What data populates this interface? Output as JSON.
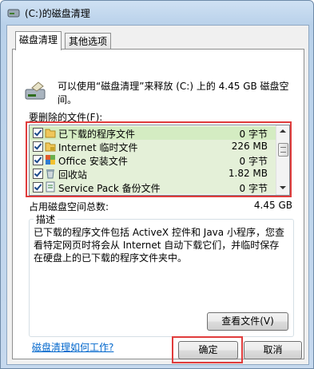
{
  "window": {
    "title": "(C:)的磁盘清理"
  },
  "tabs": [
    {
      "label": "磁盘清理"
    },
    {
      "label": "其他选项"
    }
  ],
  "intro": {
    "text": "可以使用“磁盘清理”来释放 (C:) 上的 4.45 GB 磁盘空间。"
  },
  "files_label": "要删除的文件(F):",
  "files": [
    {
      "name": "已下载的程序文件",
      "size": "0 字节",
      "checked": true,
      "icon": "folder-icon"
    },
    {
      "name": "Internet 临时文件",
      "size": "226 MB",
      "checked": true,
      "icon": "lock-folder-icon"
    },
    {
      "name": "Office 安装文件",
      "size": "0 字节",
      "checked": true,
      "icon": "office-icon"
    },
    {
      "name": "回收站",
      "size": "1.82 MB",
      "checked": true,
      "icon": "recycle-bin-icon"
    },
    {
      "name": "Service Pack 备份文件",
      "size": "0 字节",
      "checked": true,
      "icon": "backup-icon"
    }
  ],
  "total": {
    "label": "占用磁盘空间总数:",
    "value": "4.45 GB"
  },
  "description": {
    "title": "描述",
    "text": "已下载的程序文件包括 ActiveX 控件和 Java 小程序，您查看特定网页时将会从 Internet 自动下载它们，并临时保存在硬盘上的已下载的程序文件夹中。"
  },
  "buttons": {
    "view_files": "查看文件(V)",
    "ok": "确定",
    "cancel": "取消"
  },
  "help_link": "磁盘清理如何工作?",
  "colors": {
    "highlight": "#e03c3c",
    "row_bg": "#e4f0d8",
    "link": "#0066cc"
  }
}
